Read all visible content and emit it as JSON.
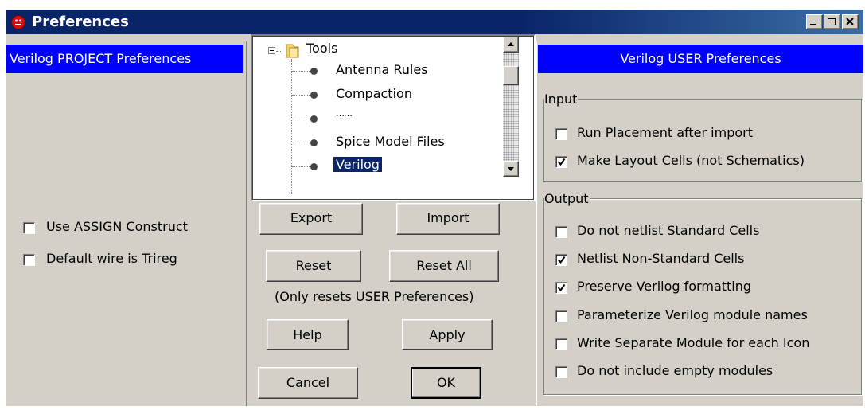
{
  "window": {
    "title": "Preferences",
    "controls": [
      "minimize-icon",
      "maximize-icon",
      "close-icon"
    ]
  },
  "project_panel": {
    "header": "Verilog PROJECT Preferences",
    "options": [
      {
        "label": "Use ASSIGN Construct",
        "checked": false
      },
      {
        "label": "Default wire is Trireg",
        "checked": false
      }
    ]
  },
  "tree": {
    "root": {
      "label": "Tools",
      "expanded": true,
      "icon": "folder-icon"
    },
    "items": [
      {
        "label": "Antenna Rules",
        "selected": false
      },
      {
        "label": "Compaction",
        "selected": false
      },
      {
        "label": "……",
        "selected": false
      },
      {
        "label": "Spice Model Files",
        "selected": false
      },
      {
        "label": "Verilog",
        "selected": true
      }
    ]
  },
  "buttons": {
    "export": "Export",
    "import": "Import",
    "reset": "Reset",
    "reset_all": "Reset All",
    "reset_note": "(Only resets USER Preferences)",
    "help": "Help",
    "apply": "Apply",
    "cancel": "Cancel",
    "ok": "OK"
  },
  "user_panel": {
    "header": "Verilog USER Preferences",
    "input_group": {
      "legend": "Input",
      "options": [
        {
          "label": "Run Placement after import",
          "checked": false
        },
        {
          "label": "Make Layout Cells (not Schematics)",
          "checked": true
        }
      ]
    },
    "output_group": {
      "legend": "Output",
      "options": [
        {
          "label": "Do not netlist Standard Cells",
          "checked": false
        },
        {
          "label": "Netlist Non-Standard Cells",
          "checked": true
        },
        {
          "label": "Preserve Verilog formatting",
          "checked": true
        },
        {
          "label": "Parameterize Verilog module names",
          "checked": false
        },
        {
          "label": "Write Separate Module for each Icon",
          "checked": false
        },
        {
          "label": "Do not include empty modules",
          "checked": false
        }
      ]
    }
  },
  "colors": {
    "header_blue": "#0000ff",
    "title_bar": "#0a246a",
    "face": "#d4d0c8",
    "selection": "#0a246a"
  }
}
